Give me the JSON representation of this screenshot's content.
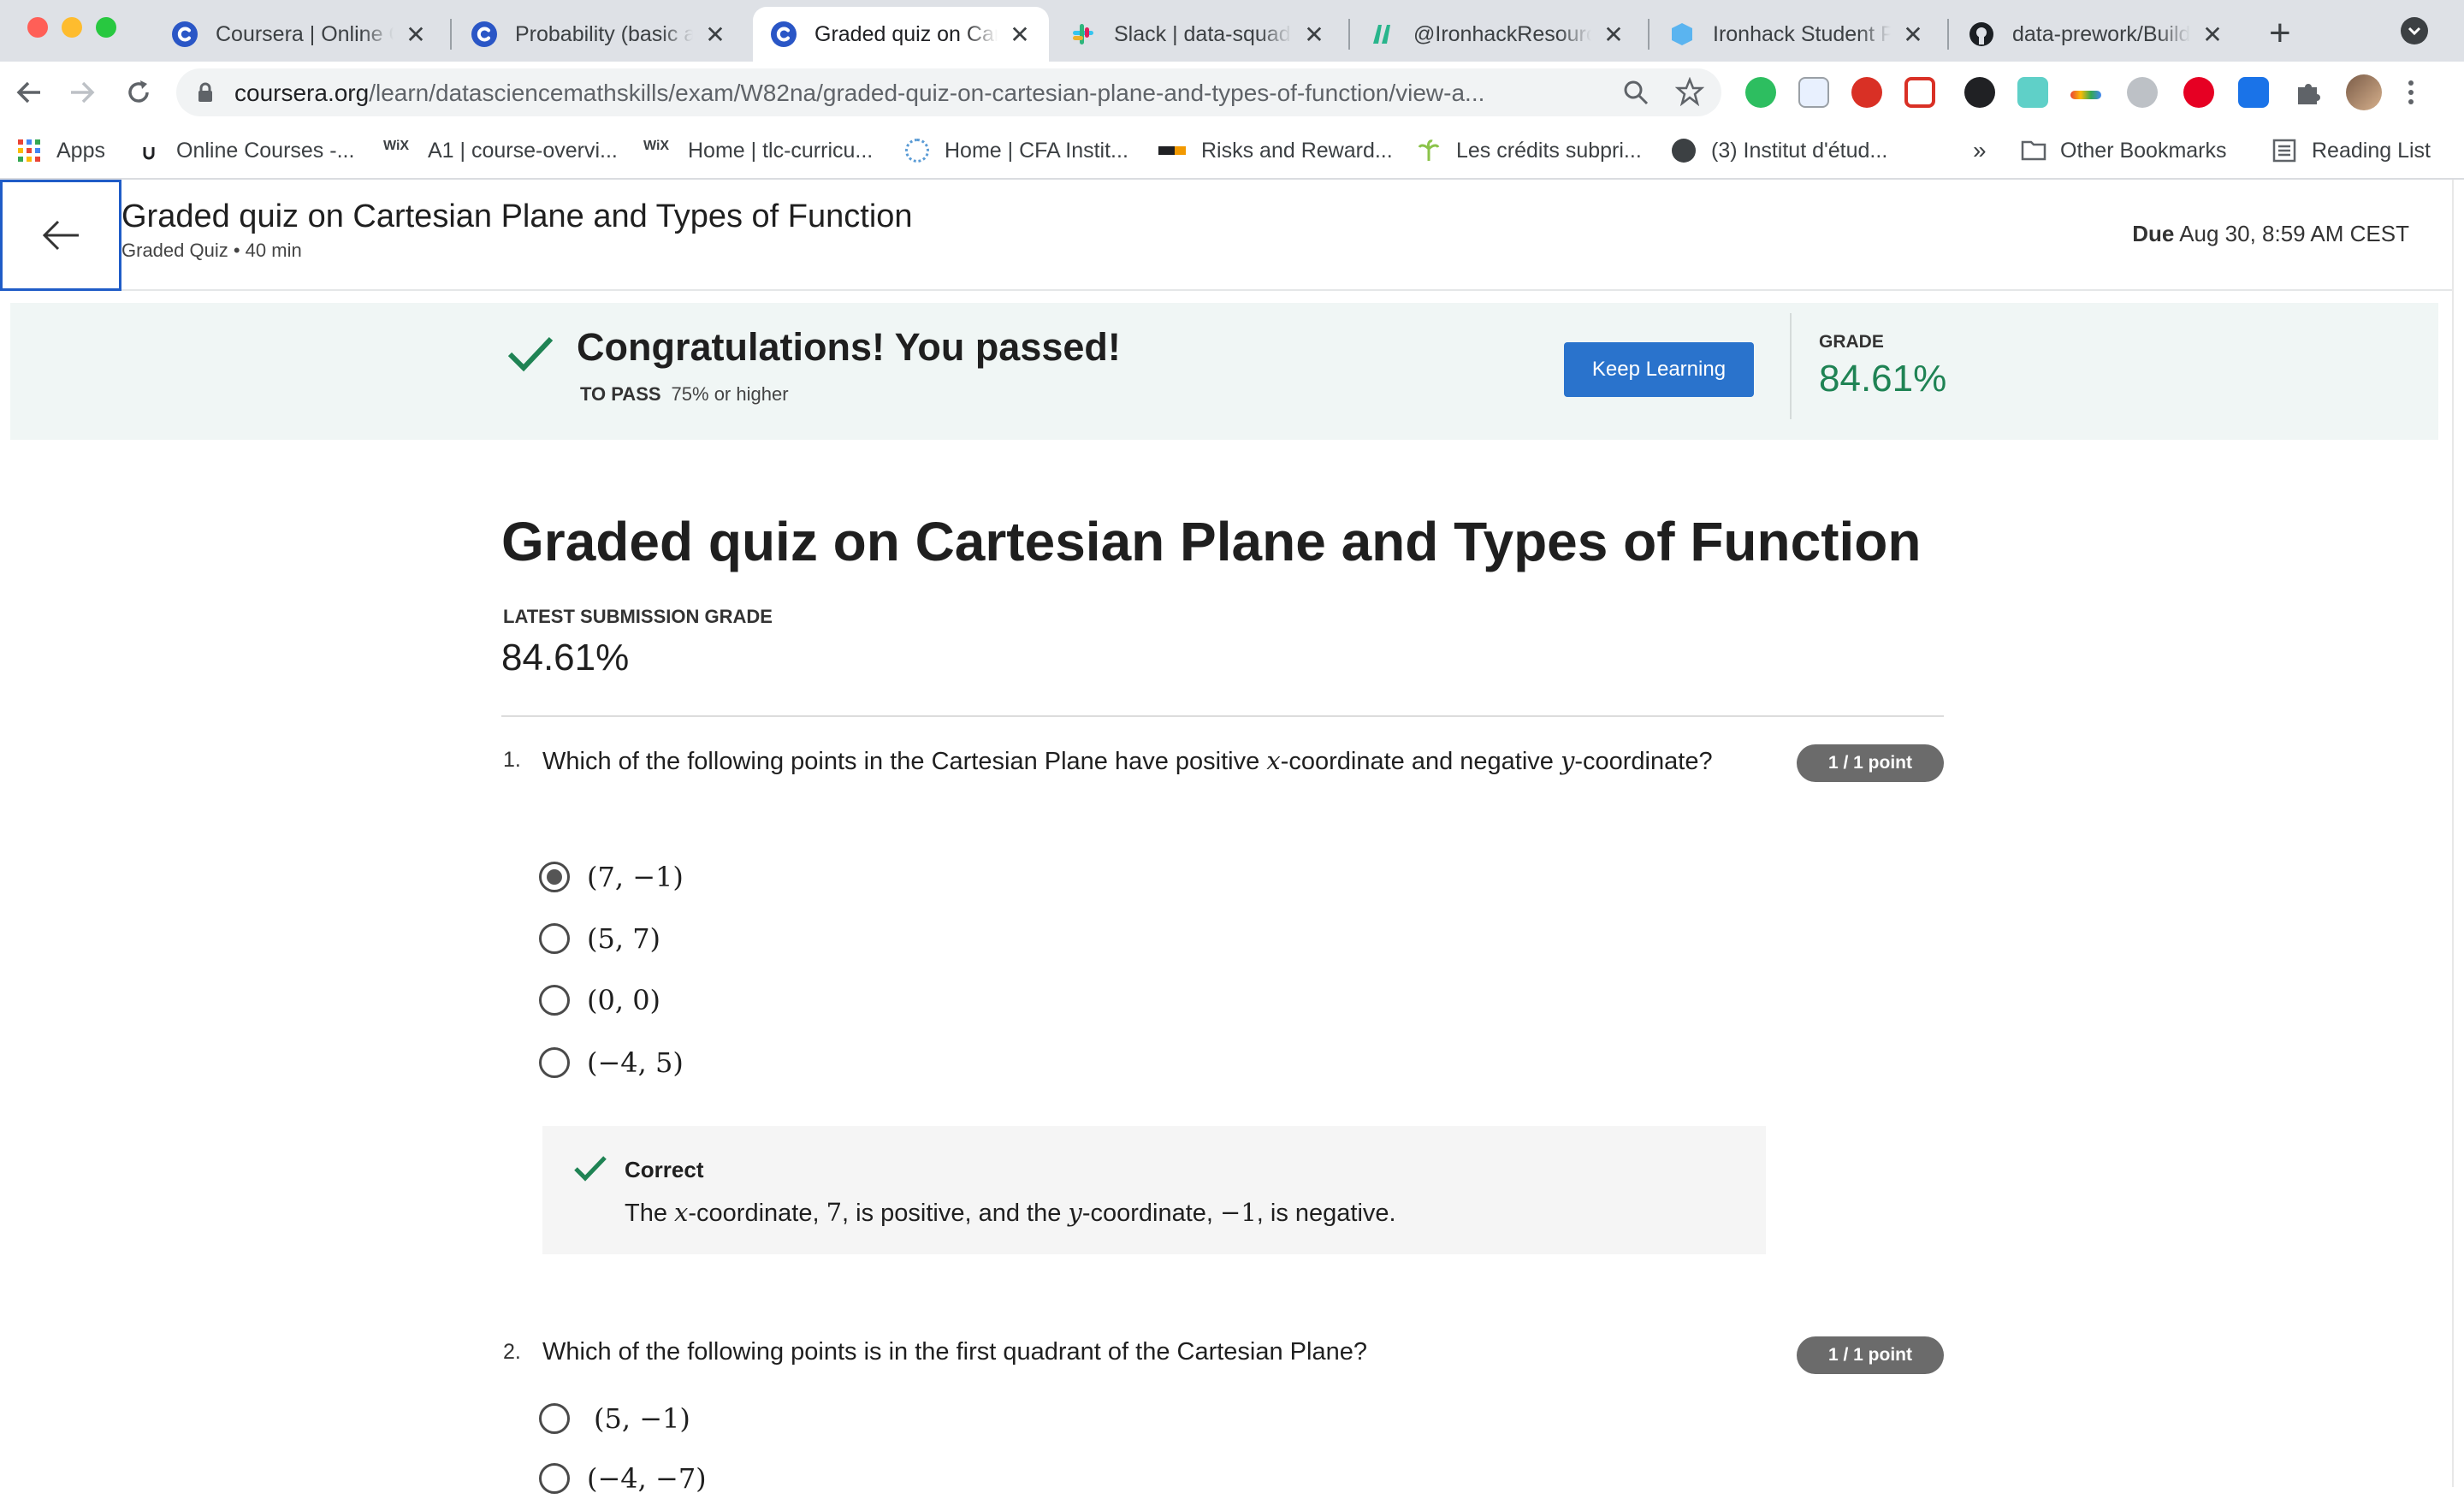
{
  "browser": {
    "tabs": [
      {
        "title": "Coursera | Online Courses",
        "icon": "coursera-icon"
      },
      {
        "title": "Probability (basic and conditional)",
        "icon": "coursera-icon"
      },
      {
        "title": "Graded quiz on Cartesian Plane",
        "icon": "coursera-icon",
        "active": true
      },
      {
        "title": "Slack | data-squad-tasks",
        "icon": "slack-icon"
      },
      {
        "title": "@IronhackResources",
        "icon": "ironhack-icon"
      },
      {
        "title": "Ironhack Student Portal",
        "icon": "portal-icon"
      },
      {
        "title": "data-prework/Build",
        "icon": "github-icon"
      }
    ],
    "url_domain": "coursera.org",
    "url_path": "/learn/datasciencemathskills/exam/W82na/graded-quiz-on-cartesian-plane-and-types-of-function/view-a...",
    "bookmarks": [
      "Apps",
      "Online Courses -...",
      "A1 | course-overvi...",
      "Home | tlc-curricu...",
      "Home | CFA Instit...",
      "Risks and Reward...",
      "Les crédits subpri...",
      "(3) Institut d'étud..."
    ],
    "bookmarks_overflow": "»",
    "other_bookmarks": "Other Bookmarks",
    "reading_list": "Reading List"
  },
  "header": {
    "title": "Graded quiz on Cartesian Plane and Types of Function",
    "subtitle": "Graded Quiz • 40 min",
    "due_label": "Due",
    "due_value": "Aug 30, 8:59 AM CEST"
  },
  "banner": {
    "title": "Congratulations! You passed!",
    "to_pass_label": "TO PASS",
    "to_pass_value": "75% or higher",
    "button": "Keep Learning",
    "grade_label": "GRADE",
    "grade_value": "84.61%"
  },
  "quiz": {
    "title": "Graded quiz on Cartesian Plane and Types of Function",
    "latest_label": "LATEST SUBMISSION GRADE",
    "latest_value": "84.61%",
    "questions": [
      {
        "number": "1.",
        "text_a": "Which of the following points in the Cartesian Plane have positive ",
        "var1": "x",
        "text_b": "-coordinate and negative ",
        "var2": "y",
        "text_c": "-coordinate?",
        "points": "1 / 1 point",
        "options": [
          "(7, −1)",
          "(5, 7)",
          "(0, 0)",
          "(−4, 5)"
        ],
        "selected_index": 0,
        "feedback": {
          "title": "Correct",
          "t1": "The ",
          "v1": "x",
          "t2": "-coordinate, ",
          "n1": "7",
          "t3": ", is positive, and the ",
          "v2": "y",
          "t4": "-coordinate, ",
          "n2": "−1",
          "t5": ", is negative."
        }
      },
      {
        "number": "2.",
        "text": "Which of the following points is in the first quadrant of the Cartesian Plane?",
        "points": "1 / 1 point",
        "options": [
          "(5, −1)",
          "(−4, −7)"
        ]
      }
    ]
  },
  "colors": {
    "accent_blue": "#2a73cc",
    "success_green": "#1f8354",
    "banner_bg": "#f0f6f5"
  }
}
